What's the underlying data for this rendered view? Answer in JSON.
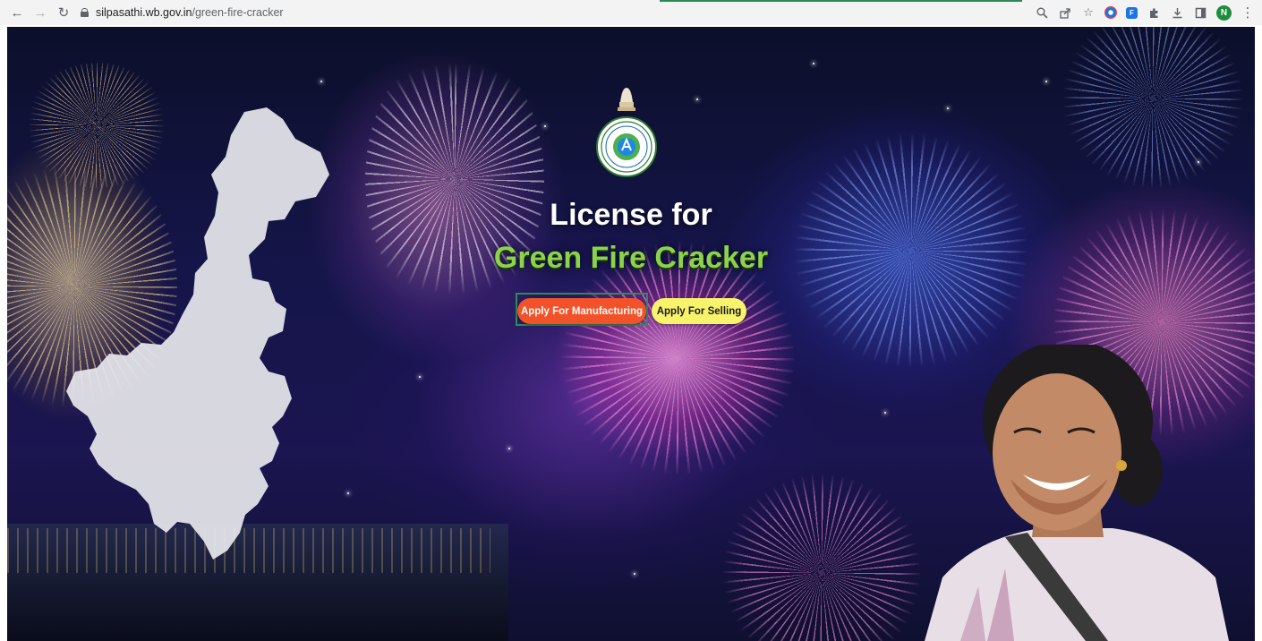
{
  "browser": {
    "url_domain": "silpasathi.wb.gov.in",
    "url_path": "/green-fire-cracker",
    "profile_initial": "N",
    "icons": [
      "back-icon",
      "forward-icon",
      "reload-icon",
      "lock-icon",
      "zoom-icon",
      "share-icon",
      "bookmark-star-icon",
      "chrome-extension-icon",
      "extension-icon",
      "puzzle-icon",
      "download-icon",
      "sidepanel-icon",
      "profile-avatar",
      "more-menu-icon"
    ]
  },
  "hero": {
    "title_line1": "License for",
    "title_line2": "Green Fire Cracker",
    "buttons": {
      "manufacturing": "Apply For Manufacturing",
      "selling": "Apply For Selling"
    },
    "emblem_label": "Government of West Bengal emblem"
  },
  "colors": {
    "manufacturing_button": "#f2522a",
    "selling_button": "#f7f36a",
    "title_green": "#8bd44a",
    "highlight_border": "#2e8b57"
  }
}
